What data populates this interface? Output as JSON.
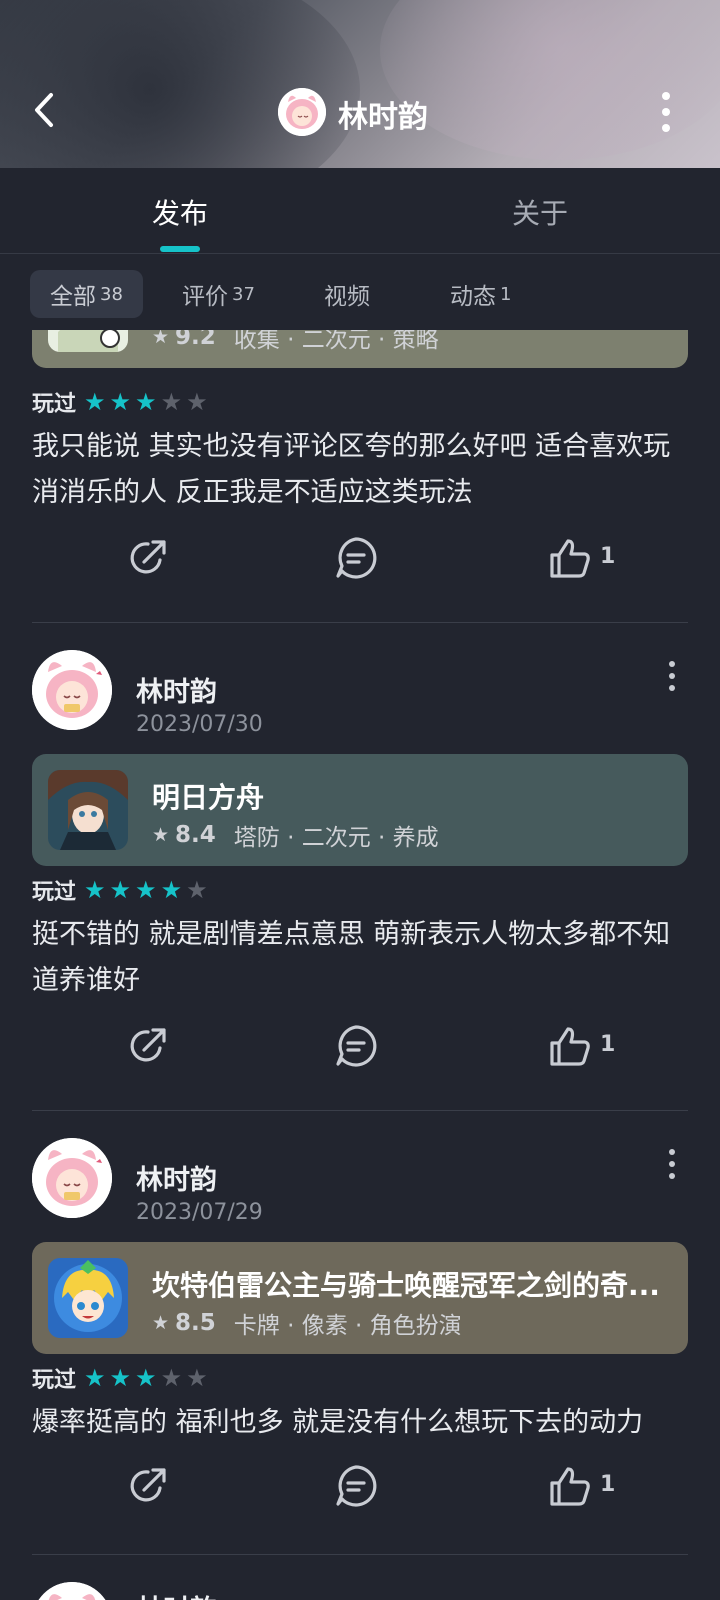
{
  "header": {
    "title": "林时韵",
    "back_icon": "back-arrow-icon",
    "more_icon": "more-vertical-icon"
  },
  "tabs": [
    {
      "label": "发布",
      "active": true
    },
    {
      "label": "关于",
      "active": false
    }
  ],
  "filters": [
    {
      "label": "全部",
      "count": "38",
      "active": true
    },
    {
      "label": "评价",
      "count": "37",
      "active": false
    },
    {
      "label": "视频",
      "count": "",
      "active": false
    },
    {
      "label": "动态",
      "count": "1",
      "active": false
    }
  ],
  "accent_color": "#16c3c9",
  "posts": [
    {
      "game": {
        "name": "",
        "score": "9.2",
        "tags": "收集 · 二次元 · 策略",
        "card_color": "#7d806f"
      },
      "played_label": "玩过",
      "rating": 3,
      "review": "我只能说 其实也没有评论区夸的那么好吧 适合喜欢玩消消乐的人 反正我是不适应这类玩法",
      "likes": "1"
    },
    {
      "user": {
        "name": "林时韵",
        "date": "2023/07/30"
      },
      "game": {
        "name": "明日方舟",
        "score": "8.4",
        "tags": "塔防 · 二次元 · 养成",
        "card_color": "#465a5c"
      },
      "played_label": "玩过",
      "rating": 4,
      "review": "挺不错的 就是剧情差点意思 萌新表示人物太多都不知道养谁好",
      "likes": "1"
    },
    {
      "user": {
        "name": "林时韵",
        "date": "2023/07/29"
      },
      "game": {
        "name": "坎特伯雷公主与骑士唤醒冠军之剑的奇...",
        "score": "8.5",
        "tags": "卡牌 · 像素 · 角色扮演",
        "card_color": "#6e695b"
      },
      "played_label": "玩过",
      "rating": 3,
      "review": "爆率挺高的 福利也多 就是没有什么想玩下去的动力",
      "likes": "1"
    },
    {
      "user": {
        "name": "林时韵",
        "date": ""
      }
    }
  ]
}
